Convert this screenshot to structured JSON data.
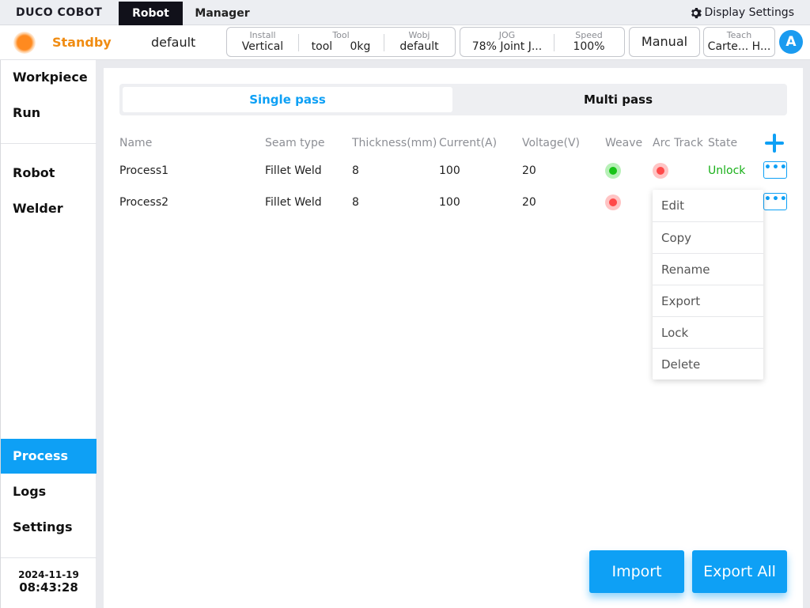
{
  "topbar": {
    "logo": "DUCO COBOT",
    "tabs": [
      "Robot",
      "Manager"
    ],
    "display_settings": "Display Settings"
  },
  "status": {
    "state": "Standby",
    "program": "default",
    "install": {
      "label": "Install",
      "value": "Vertical"
    },
    "tool": {
      "label": "Tool",
      "name": "tool",
      "load": "0kg"
    },
    "wobj": {
      "label": "Wobj",
      "value": "default"
    },
    "jog": {
      "label": "JOG",
      "value": "78%  Joint J..."
    },
    "speed": {
      "label": "Speed",
      "value": "100%"
    },
    "mode": "Manual",
    "teach": {
      "label": "Teach",
      "value": "Carte... H..."
    },
    "user_initial": "A"
  },
  "sidebar": {
    "items": [
      "Workpiece",
      "Run",
      "Robot",
      "Welder",
      "Process",
      "Logs",
      "Settings"
    ],
    "active": "Process",
    "date": "2024-11-19",
    "time": "08:43:28"
  },
  "main": {
    "tabs": {
      "single": "Single pass",
      "multi": "Multi pass"
    },
    "columns": [
      "Name",
      "Seam type",
      "Thickness(mm)",
      "Current(A)",
      "Voltage(V)",
      "Weave",
      "Arc Track",
      "State"
    ],
    "rows": [
      {
        "name": "Process1",
        "seam": "Fillet Weld",
        "thickness": "8",
        "current": "100",
        "voltage": "20",
        "weave": "green",
        "arc_track": "red",
        "state": "Unlock",
        "more": "•••"
      },
      {
        "name": "Process2",
        "seam": "Fillet Weld",
        "thickness": "8",
        "current": "100",
        "voltage": "20",
        "weave": "red",
        "arc_track": "",
        "state": "",
        "more": "•••"
      }
    ],
    "context_menu": [
      "Edit",
      "Copy",
      "Rename",
      "Export",
      "Lock",
      "Delete"
    ],
    "import_label": "Import",
    "export_all_label": "Export All"
  },
  "colors": {
    "accent": "#0ea0f5",
    "standby": "#f08c12",
    "unlock": "#19b019"
  }
}
